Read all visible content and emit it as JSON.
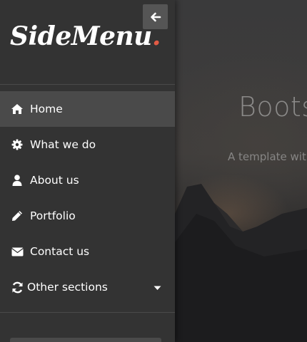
{
  "hero": {
    "title": "Boots",
    "subtitle": "A template with"
  },
  "sidebar": {
    "logo_text": "SideMenu",
    "logo_dot": ".",
    "dismiss_icon": "arrow-left-icon",
    "items": [
      {
        "label": "Home",
        "icon": "home-icon",
        "active": true
      },
      {
        "label": "What we do",
        "icon": "gear-icon",
        "active": false
      },
      {
        "label": "About us",
        "icon": "user-icon",
        "active": false
      },
      {
        "label": "Portfolio",
        "icon": "pencil-icon",
        "active": false
      },
      {
        "label": "Contact us",
        "icon": "envelope-icon",
        "active": false
      },
      {
        "label": "Other sections",
        "icon": "refresh-icon",
        "active": false,
        "has_dropdown": true
      }
    ]
  },
  "colors": {
    "sidebar_bg": "#333333",
    "active_bg": "#4a4a4a",
    "accent": "#e25b45",
    "text": "#ffffff"
  }
}
